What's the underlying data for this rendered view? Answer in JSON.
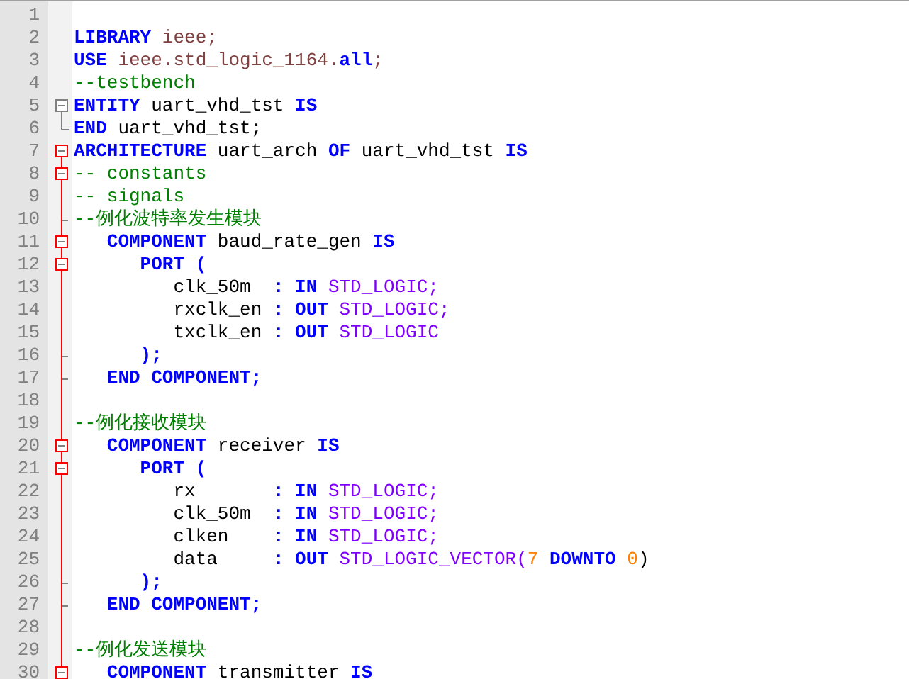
{
  "editor": {
    "lines": [
      {
        "number": "1"
      },
      {
        "number": "2",
        "tokens": [
          {
            "kind": "kw",
            "text": "LIBRARY"
          },
          {
            "kind": "lib",
            "text": " ieee;"
          }
        ]
      },
      {
        "number": "3",
        "tokens": [
          {
            "kind": "kw",
            "text": "USE"
          },
          {
            "kind": "lib",
            "text": " ieee.std_logic_1164."
          },
          {
            "kind": "kw",
            "text": "all"
          },
          {
            "kind": "lib",
            "text": ";"
          }
        ]
      },
      {
        "number": "4",
        "tokens": [
          {
            "kind": "comment",
            "text": "--testbench"
          }
        ]
      },
      {
        "number": "5",
        "fold": {
          "kind": "start",
          "active": false
        },
        "tokens": [
          {
            "kind": "kw",
            "text": "ENTITY"
          },
          {
            "kind": "id",
            "text": " uart_vhd_tst "
          },
          {
            "kind": "kw",
            "text": "IS"
          }
        ]
      },
      {
        "number": "6",
        "fold": {
          "kind": "end",
          "active": false
        },
        "tokens": [
          {
            "kind": "kw",
            "text": "END"
          },
          {
            "kind": "id",
            "text": " uart_vhd_tst;"
          }
        ]
      },
      {
        "number": "7",
        "fold": {
          "kind": "start",
          "active": true
        },
        "tokens": [
          {
            "kind": "kw",
            "text": "ARCHITECTURE"
          },
          {
            "kind": "id",
            "text": " uart_arch "
          },
          {
            "kind": "kw",
            "text": "OF"
          },
          {
            "kind": "id",
            "text": " uart_vhd_tst "
          },
          {
            "kind": "kw",
            "text": "IS"
          }
        ]
      },
      {
        "number": "8",
        "fold": {
          "kind": "box",
          "active": true
        },
        "tokens": [
          {
            "kind": "comment",
            "text": "-- constants"
          }
        ]
      },
      {
        "number": "9",
        "fold": {
          "kind": "line",
          "active": true
        },
        "tokens": [
          {
            "kind": "comment",
            "text": "-- signals"
          }
        ]
      },
      {
        "number": "10",
        "fold": {
          "kind": "tick",
          "active": true
        },
        "tokens": [
          {
            "kind": "comment",
            "text": "--例化波特率发生模块"
          }
        ]
      },
      {
        "number": "11",
        "fold": {
          "kind": "box",
          "active": true
        },
        "tokens": [
          {
            "kind": "kw",
            "text": "   COMPONENT"
          },
          {
            "kind": "id",
            "text": " baud_rate_gen "
          },
          {
            "kind": "kw",
            "text": "IS"
          }
        ]
      },
      {
        "number": "12",
        "fold": {
          "kind": "box",
          "active": true
        },
        "tokens": [
          {
            "kind": "kw",
            "text": "      PORT ("
          }
        ]
      },
      {
        "number": "13",
        "fold": {
          "kind": "line",
          "active": true
        },
        "tokens": [
          {
            "kind": "id",
            "text": "         clk_50m  "
          },
          {
            "kind": "kw",
            "text": ": IN"
          },
          {
            "kind": "type",
            "text": " STD_LOGIC;"
          }
        ]
      },
      {
        "number": "14",
        "fold": {
          "kind": "line",
          "active": true
        },
        "tokens": [
          {
            "kind": "id",
            "text": "         rxclk_en "
          },
          {
            "kind": "kw",
            "text": ": OUT"
          },
          {
            "kind": "type",
            "text": " STD_LOGIC;"
          }
        ]
      },
      {
        "number": "15",
        "fold": {
          "kind": "line",
          "active": true
        },
        "tokens": [
          {
            "kind": "id",
            "text": "         txclk_en "
          },
          {
            "kind": "kw",
            "text": ": OUT"
          },
          {
            "kind": "type",
            "text": " STD_LOGIC"
          }
        ]
      },
      {
        "number": "16",
        "fold": {
          "kind": "tick",
          "active": true
        },
        "tokens": [
          {
            "kind": "kw",
            "text": "      );"
          }
        ]
      },
      {
        "number": "17",
        "fold": {
          "kind": "tick",
          "active": true
        },
        "tokens": [
          {
            "kind": "kw",
            "text": "   END COMPONENT;"
          }
        ]
      },
      {
        "number": "18",
        "fold": {
          "kind": "line",
          "active": true
        }
      },
      {
        "number": "19",
        "fold": {
          "kind": "line",
          "active": true
        },
        "tokens": [
          {
            "kind": "comment",
            "text": "--例化接收模块"
          }
        ]
      },
      {
        "number": "20",
        "fold": {
          "kind": "box",
          "active": true
        },
        "tokens": [
          {
            "kind": "kw",
            "text": "   COMPONENT"
          },
          {
            "kind": "id",
            "text": " receiver "
          },
          {
            "kind": "kw",
            "text": "IS"
          }
        ]
      },
      {
        "number": "21",
        "fold": {
          "kind": "box",
          "active": true
        },
        "tokens": [
          {
            "kind": "kw",
            "text": "      PORT ("
          }
        ]
      },
      {
        "number": "22",
        "fold": {
          "kind": "line",
          "active": true
        },
        "tokens": [
          {
            "kind": "id",
            "text": "         rx       "
          },
          {
            "kind": "kw",
            "text": ": IN"
          },
          {
            "kind": "type",
            "text": " STD_LOGIC;"
          }
        ]
      },
      {
        "number": "23",
        "fold": {
          "kind": "line",
          "active": true
        },
        "tokens": [
          {
            "kind": "id",
            "text": "         clk_50m  "
          },
          {
            "kind": "kw",
            "text": ": IN"
          },
          {
            "kind": "type",
            "text": " STD_LOGIC;"
          }
        ]
      },
      {
        "number": "24",
        "fold": {
          "kind": "line",
          "active": true
        },
        "tokens": [
          {
            "kind": "id",
            "text": "         clken    "
          },
          {
            "kind": "kw",
            "text": ": IN"
          },
          {
            "kind": "type",
            "text": " STD_LOGIC;"
          }
        ]
      },
      {
        "number": "25",
        "fold": {
          "kind": "line",
          "active": true
        },
        "tokens": [
          {
            "kind": "id",
            "text": "         data     "
          },
          {
            "kind": "kw",
            "text": ": OUT"
          },
          {
            "kind": "type",
            "text": " STD_LOGIC_VECTOR("
          },
          {
            "kind": "num",
            "text": "7"
          },
          {
            "kind": "kw",
            "text": " DOWNTO "
          },
          {
            "kind": "num",
            "text": "0"
          },
          {
            "kind": "id",
            "text": ")"
          }
        ]
      },
      {
        "number": "26",
        "fold": {
          "kind": "tick",
          "active": true
        },
        "tokens": [
          {
            "kind": "kw",
            "text": "      );"
          }
        ]
      },
      {
        "number": "27",
        "fold": {
          "kind": "tick",
          "active": true
        },
        "tokens": [
          {
            "kind": "kw",
            "text": "   END COMPONENT;"
          }
        ]
      },
      {
        "number": "28",
        "fold": {
          "kind": "line",
          "active": true
        }
      },
      {
        "number": "29",
        "fold": {
          "kind": "line",
          "active": true
        },
        "tokens": [
          {
            "kind": "comment",
            "text": "--例化发送模块"
          }
        ]
      },
      {
        "number": "30",
        "fold": {
          "kind": "box",
          "active": true
        },
        "tokens": [
          {
            "kind": "kw",
            "text": "   COMPONENT"
          },
          {
            "kind": "id",
            "text": " transmitter "
          },
          {
            "kind": "kw",
            "text": "IS"
          }
        ]
      }
    ]
  }
}
